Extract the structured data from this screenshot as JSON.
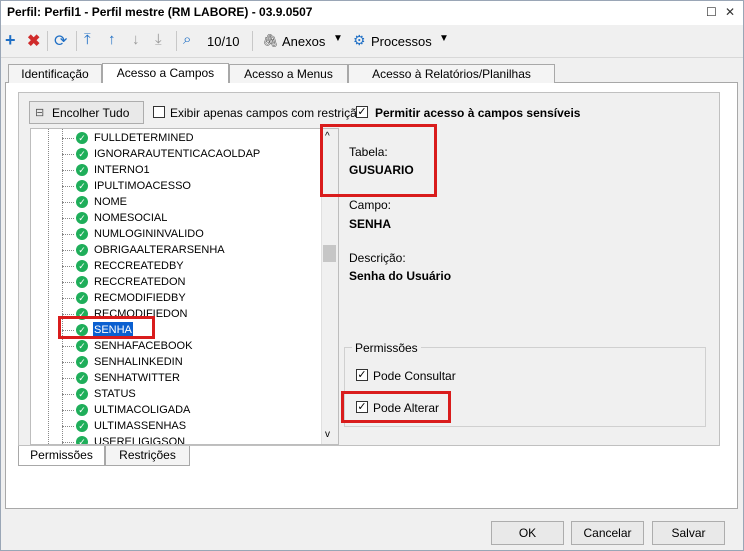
{
  "window": {
    "title": "Perfil: Perfil1 - Perfil mestre (RM LABORE) - 03.9.0507"
  },
  "toolbar": {
    "record_counter": "10/10",
    "anexos_label": "Anexos",
    "processos_label": "Processos"
  },
  "tabs": [
    "Identificação",
    "Acesso a Campos",
    "Acesso a Menus",
    "Acesso à Relatórios/Planilhas"
  ],
  "options": {
    "collapse_button": "Encolher Tudo",
    "show_restricted_label": "Exibir apenas campos com restrição",
    "sensitive_access_label": "Permitir acesso à campos sensíveis"
  },
  "tree_items": [
    "FULLDETERMINED",
    "IGNORARAUTENTICACAOLDAP",
    "INTERNO1",
    "IPULTIMOACESSO",
    "NOME",
    "NOMESOCIAL",
    "NUMLOGININVALIDO",
    "OBRIGAALTERARSENHA",
    "RECCREATEDBY",
    "RECCREATEDON",
    "RECMODIFIEDBY",
    "RECMODIFIEDON",
    "SENHA",
    "SENHAFACEBOOK",
    "SENHALINKEDIN",
    "SENHATWITTER",
    "STATUS",
    "ULTIMACOLIGADA",
    "ULTIMASSENHAS",
    "USERELIGIGSON"
  ],
  "details": {
    "tabela_label": "Tabela:",
    "tabela_value": "GUSUARIO",
    "campo_label": "Campo:",
    "campo_value": "SENHA",
    "descricao_label": "Descrição:",
    "descricao_value": "Senha do Usuário"
  },
  "permissions": {
    "group_label": "Permissões",
    "consultar_label": "Pode Consultar",
    "alterar_label": "Pode Alterar"
  },
  "bottom_tabs": [
    "Permissões",
    "Restrições"
  ],
  "footer": {
    "ok": "OK",
    "cancel": "Cancelar",
    "save": "Salvar"
  }
}
